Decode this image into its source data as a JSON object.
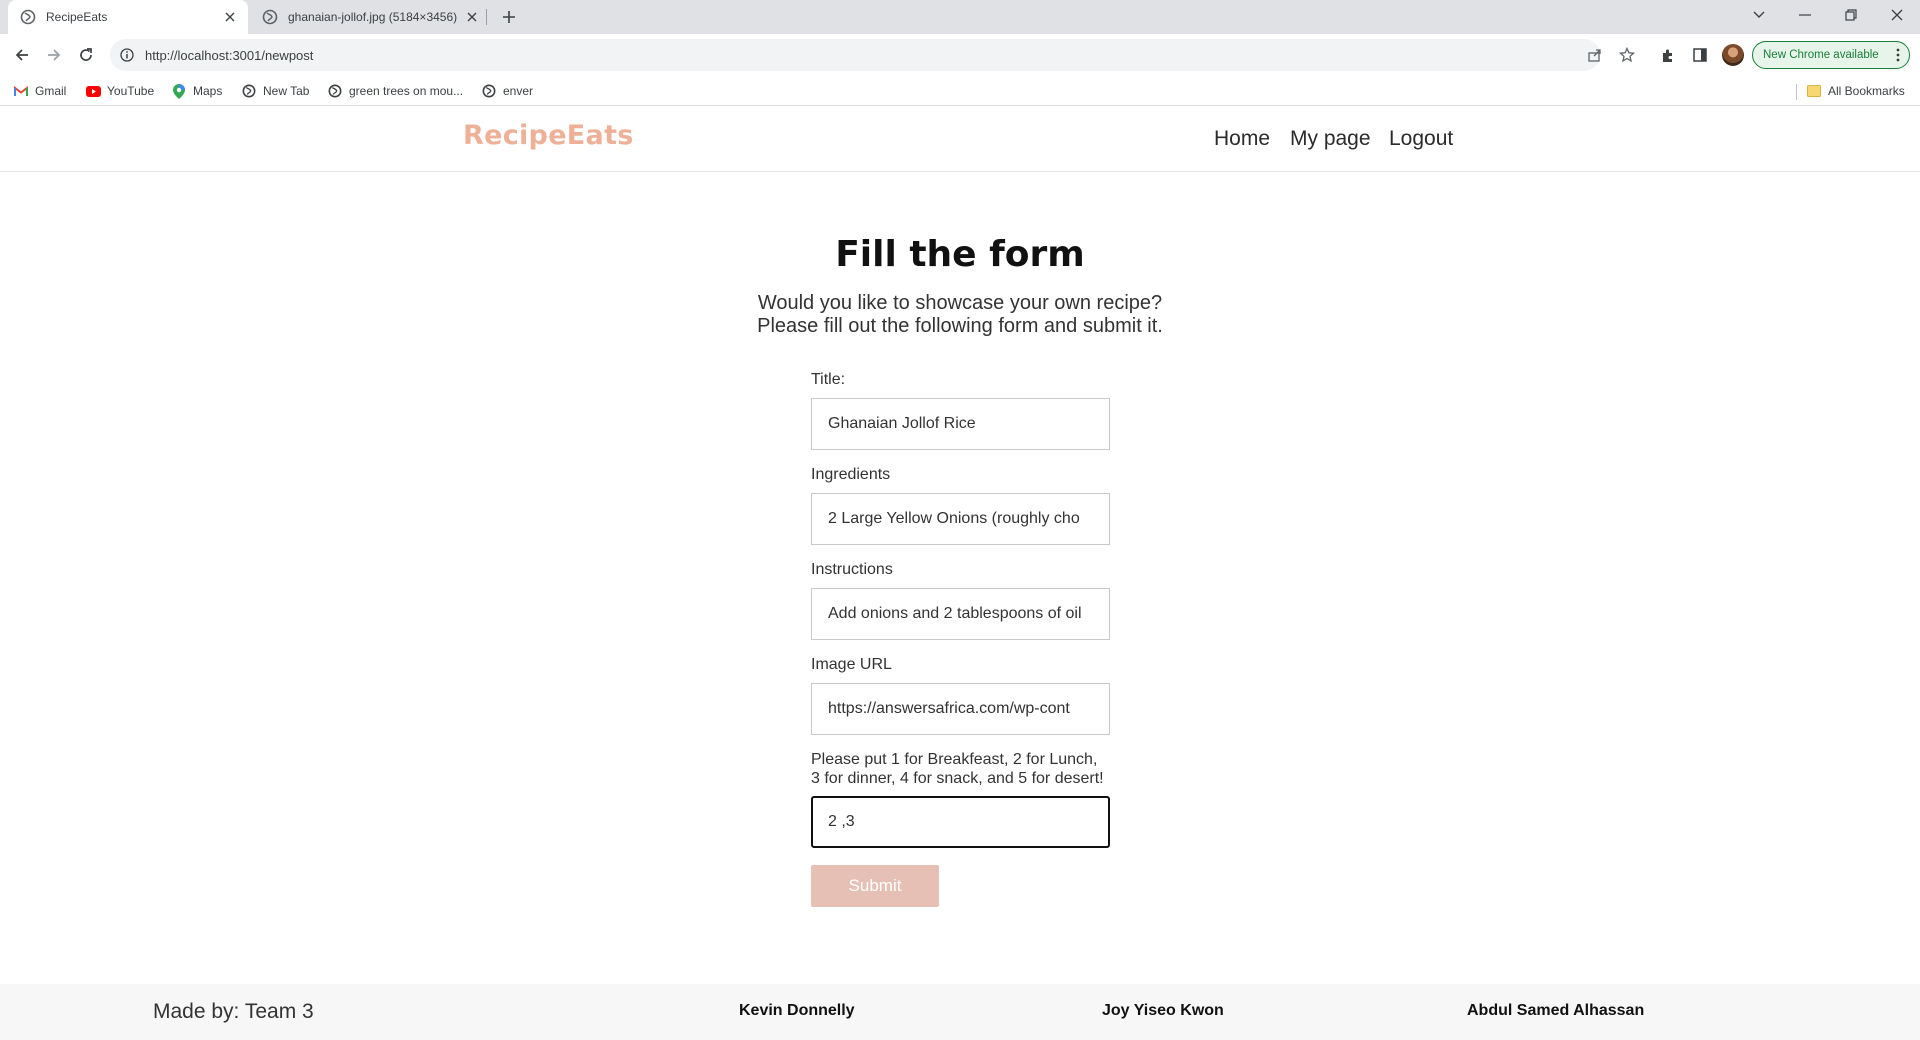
{
  "browser": {
    "tabs": [
      {
        "title": "RecipeEats",
        "active": true
      },
      {
        "title": "ghanaian-jollof.jpg (5184×3456)",
        "active": false
      }
    ],
    "address": "http://localhost:3001/newpost",
    "update_label": "New Chrome available",
    "bookmarks": [
      {
        "label": "Gmail",
        "icon": "gmail-icon"
      },
      {
        "label": "YouTube",
        "icon": "youtube-icon"
      },
      {
        "label": "Maps",
        "icon": "maps-icon"
      },
      {
        "label": "New Tab",
        "icon": "globe-icon"
      },
      {
        "label": "green trees on mou...",
        "icon": "globe-icon"
      },
      {
        "label": "enver",
        "icon": "globe-icon"
      }
    ],
    "all_bookmarks": "All Bookmarks"
  },
  "site": {
    "logo": "RecipeEats",
    "brand_color": "#eeb197",
    "nav": {
      "home": "Home",
      "my_page": "My page",
      "logout": "Logout"
    }
  },
  "form": {
    "heading": "Fill the form",
    "intro_line1": "Would you like to showcase your own recipe?",
    "intro_line2": "Please fill out the following form and submit it.",
    "title_label": "Title:",
    "title_value": "Ghanaian Jollof Rice",
    "ingredients_label": "Ingredients",
    "ingredients_value": "2  Large Yellow Onions (roughly cho",
    "instructions_label": "Instructions",
    "instructions_value": "Add onions and 2 tablespoons of oil",
    "image_label": "Image URL",
    "image_value": "https://answersafrica.com/wp-cont",
    "category_label_line1": "Please put 1 for Breakfeast, 2 for Lunch,",
    "category_label_line2": "3 for dinner, 4 for snack, and 5 for desert!",
    "category_value": "2 ,3",
    "submit_label": "Submit",
    "submit_color": "#e6c0b4"
  },
  "footer": {
    "made_by": "Made by: Team 3",
    "members": [
      "Kevin Donnelly",
      "Joy Yiseo Kwon",
      "Abdul Samed Alhassan"
    ]
  }
}
